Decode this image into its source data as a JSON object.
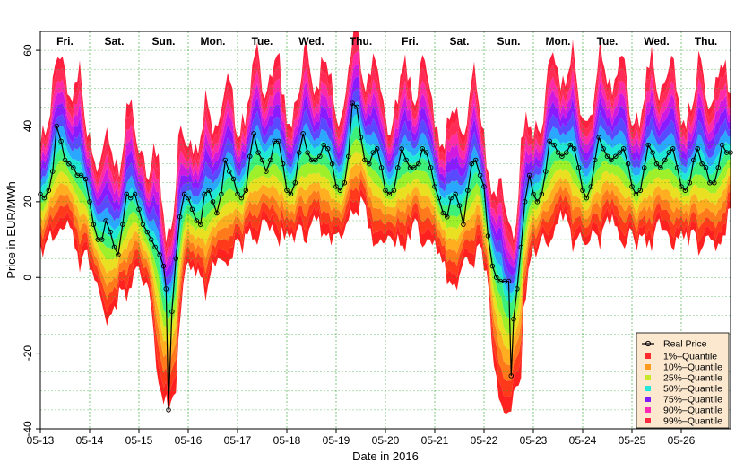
{
  "chart_data": {
    "type": "area",
    "title": "",
    "xlabel": "Date in 2016",
    "ylabel": "Price in EUR/MWh",
    "ylim": [
      -40,
      65
    ],
    "xlim_days": [
      0,
      14
    ],
    "yticks": [
      -40,
      -20,
      0,
      20,
      40,
      60
    ],
    "x_ticks": [
      "05-13",
      "05-14",
      "05-15",
      "05-16",
      "05-17",
      "05-18",
      "05-19",
      "05-20",
      "05-21",
      "05-22",
      "05-23",
      "05-24",
      "05-25",
      "05-26"
    ],
    "weekday_labels": [
      "Fri.",
      "Sat.",
      "Sun.",
      "Mon.",
      "Tue.",
      "Wed.",
      "Thu.",
      "Fri.",
      "Sat.",
      "Sun.",
      "Mon.",
      "Tue.",
      "Wed.",
      "Thu."
    ],
    "grid": true,
    "legend_position": "bottom-right",
    "legend": {
      "real_price": "Real Price",
      "quantiles": [
        {
          "label": "1%–Quantile",
          "color": "#ff2a2a"
        },
        {
          "label": "10%–Quantile",
          "color": "#ff9a1f"
        },
        {
          "label": "25%–Quantile",
          "color": "#c8e62a"
        },
        {
          "label": "50%–Quantile",
          "color": "#24e6d8"
        },
        {
          "label": "75%–Quantile",
          "color": "#7f1bff"
        },
        {
          "label": "90%–Quantile",
          "color": "#ff2ab4"
        },
        {
          "label": "99%–Quantile",
          "color": "#ff2a40"
        }
      ]
    },
    "real_price": {
      "x_days": [
        0.0,
        0.08,
        0.17,
        0.25,
        0.33,
        0.42,
        0.5,
        0.58,
        0.67,
        0.75,
        0.83,
        0.92,
        1.0,
        1.08,
        1.17,
        1.25,
        1.33,
        1.42,
        1.5,
        1.58,
        1.67,
        1.75,
        1.83,
        1.92,
        2.0,
        2.08,
        2.17,
        2.25,
        2.33,
        2.42,
        2.5,
        2.55,
        2.6,
        2.67,
        2.75,
        2.83,
        2.92,
        3.0,
        3.08,
        3.17,
        3.25,
        3.33,
        3.42,
        3.5,
        3.58,
        3.67,
        3.75,
        3.83,
        3.92,
        4.0,
        4.08,
        4.17,
        4.25,
        4.33,
        4.42,
        4.5,
        4.58,
        4.67,
        4.75,
        4.83,
        4.92,
        5.0,
        5.08,
        5.17,
        5.25,
        5.33,
        5.42,
        5.5,
        5.58,
        5.67,
        5.75,
        5.83,
        5.92,
        6.0,
        6.08,
        6.17,
        6.25,
        6.33,
        6.42,
        6.5,
        6.58,
        6.67,
        6.75,
        6.83,
        6.92,
        7.0,
        7.08,
        7.17,
        7.25,
        7.33,
        7.42,
        7.5,
        7.58,
        7.67,
        7.75,
        7.83,
        7.92,
        8.0,
        8.08,
        8.17,
        8.25,
        8.33,
        8.42,
        8.5,
        8.58,
        8.67,
        8.75,
        8.83,
        8.92,
        9.0,
        9.08,
        9.17,
        9.25,
        9.33,
        9.42,
        9.5,
        9.55,
        9.6,
        9.67,
        9.75,
        9.83,
        9.92,
        10.0,
        10.08,
        10.17,
        10.25,
        10.33,
        10.42,
        10.5,
        10.58,
        10.67,
        10.75,
        10.83,
        10.92,
        11.0,
        11.08,
        11.17,
        11.25,
        11.33,
        11.42,
        11.5,
        11.58,
        11.67,
        11.75,
        11.83,
        11.92,
        12.0,
        12.08,
        12.17,
        12.25,
        12.33,
        12.42,
        12.5,
        12.58,
        12.67,
        12.75,
        12.83,
        12.92,
        13.0,
        13.08,
        13.17,
        13.25,
        13.33,
        13.42,
        13.5,
        13.58,
        13.67,
        13.75,
        13.83,
        13.92,
        14.0
      ],
      "values": [
        22,
        21,
        23,
        28,
        40,
        36,
        31,
        30,
        29,
        27,
        27,
        26,
        20,
        14,
        10,
        10,
        15,
        12,
        8,
        6,
        14,
        22,
        21,
        22,
        18,
        14,
        12,
        10,
        8,
        6,
        3,
        -3,
        -35,
        -9,
        5,
        16,
        22,
        21,
        18,
        15,
        14,
        22,
        23,
        20,
        17,
        22,
        31,
        28,
        26,
        22,
        21,
        23,
        32,
        38,
        33,
        31,
        28,
        31,
        36,
        36,
        30,
        23,
        22,
        25,
        33,
        38,
        33,
        31,
        31,
        32,
        35,
        34,
        30,
        24,
        23,
        25,
        32,
        46,
        45,
        37,
        31,
        30,
        33,
        34,
        29,
        23,
        22,
        23,
        29,
        34,
        31,
        29,
        29,
        30,
        34,
        33,
        29,
        24,
        21,
        17,
        16,
        21,
        22,
        19,
        14,
        23,
        30,
        31,
        27,
        24,
        11,
        3,
        0,
        -1,
        -1,
        -1,
        -26,
        -11,
        -3,
        8,
        20,
        27,
        22,
        20,
        22,
        28,
        36,
        35,
        33,
        32,
        33,
        35,
        34,
        29,
        23,
        21,
        24,
        31,
        37,
        34,
        32,
        31,
        32,
        33,
        34,
        30,
        24,
        22,
        23,
        29,
        35,
        33,
        30,
        29,
        31,
        33,
        34,
        29,
        24,
        23,
        25,
        31,
        34,
        30,
        29,
        25,
        25,
        29,
        35,
        33,
        33
      ]
    }
  }
}
